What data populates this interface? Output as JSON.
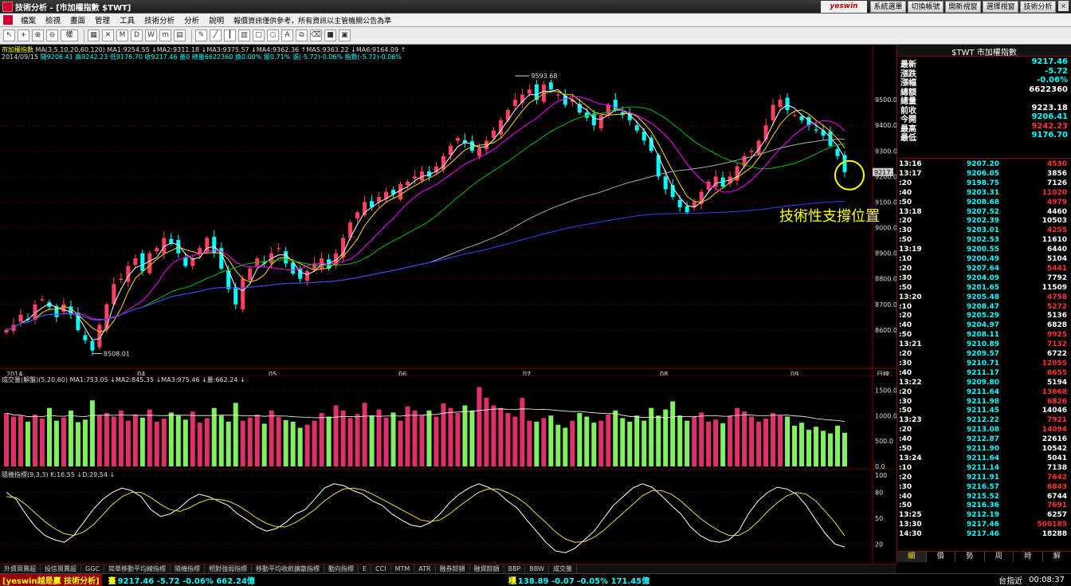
{
  "window": {
    "title": "技術分析 - [市加權指數 $TWT]",
    "brand": "yeswin",
    "right_buttons": [
      "系統選單",
      "切換帳號",
      "開新視窗",
      "選擇視窗",
      "技術分析"
    ],
    "win_controls": [
      "_",
      "▫",
      "×"
    ]
  },
  "menu": [
    "檔案",
    "檢視",
    "畫面",
    "管理",
    "工具",
    "技術分析",
    "分析",
    "說明"
  ],
  "disclaimer": "報價資訊僅供參考，所有資訊以主管機關公告為準",
  "toolbar": {
    "icons": [
      "cursor-icon",
      "crosshair-icon",
      "zoom-in-icon",
      "zoom-out-icon",
      "grid-icon",
      "close-chart-icon",
      "period-icon",
      "day-icon",
      "week-icon",
      "month-icon",
      "minute-icon",
      "draw-icon",
      "line-icon",
      "candle-icon",
      "bar-icon",
      "rect-icon",
      "circle-icon",
      "text-icon",
      "copy-icon",
      "eraser-icon",
      "color-icon",
      "save-icon"
    ],
    "rights_label": "權"
  },
  "main_chart": {
    "title_label": "市加權指數",
    "ma_line": "MA(3,5,10,20,60,120) MA1:9254.55 ↓MA2:9311.18 ↓MA3:9375.57 ↓MA4:9362.36 ↑MA5:9363.22 ↓MA6:9164.09 ↑",
    "date": "2014/09/15",
    "ohlc_line": "開9206.41 高9242.23 低9176.70 收9217.46 量0 總量6622360 換0.00% 振0.71% 漲(-5.72)-0.06% 指數(-5.72)-0.06%",
    "current_price_tag": "9217.5",
    "annotation": "技術性支撐位置",
    "x_axis_label": "日線"
  },
  "volume_chart": {
    "ma_line": "成交量(解盤)(5,20,60) MA1:753.05 ↓MA2:845.35 ↓MA3:975.46 ↓量:662.24 ↓"
  },
  "kd_chart": {
    "ma_line": "隨機指標(9,3,3) K:16.55 ↓D:29.54 ↓"
  },
  "chart_data": [
    {
      "type": "candlestick",
      "title": "市加權指數",
      "x": [
        "2014",
        "04",
        "05",
        "06",
        "07",
        "08",
        "09"
      ],
      "ylim": [
        8508.01,
        9593.68
      ],
      "y_ticks": [
        "9500.0",
        "9400.0",
        "9300.0",
        "9200.0",
        "9100.0",
        "9000.0",
        "8900.0",
        "8800.0",
        "8700.0",
        "8600.0"
      ],
      "annotations": [
        "9593.68",
        "8508.01"
      ],
      "series": [
        {
          "name": "MA1",
          "values": [
            9254.55
          ]
        },
        {
          "name": "MA2",
          "values": [
            9311.18
          ]
        },
        {
          "name": "MA3",
          "values": [
            9375.57
          ]
        },
        {
          "name": "MA4",
          "values": [
            9362.36
          ]
        },
        {
          "name": "MA5",
          "values": [
            9363.22
          ]
        },
        {
          "name": "MA6",
          "values": [
            9164.09
          ]
        }
      ],
      "close": [
        8600,
        8620,
        8660,
        8640,
        8700,
        8720,
        8690,
        8650,
        8700,
        8660,
        8600,
        8560,
        8520,
        8620,
        8700,
        8780,
        8800,
        8850,
        8880,
        8830,
        8900,
        8920,
        8960,
        8940,
        8900,
        8850,
        8880,
        8920,
        8960,
        8900,
        8840,
        8760,
        8700,
        8800,
        8840,
        8880,
        8860,
        8900,
        8920,
        8860,
        8820,
        8800,
        8830,
        8860,
        8880,
        8840,
        8900,
        8960,
        9020,
        9060,
        9100,
        9080,
        9120,
        9140,
        9130,
        9170,
        9180,
        9200,
        9220,
        9200,
        9240,
        9280,
        9320,
        9350,
        9330,
        9300,
        9310,
        9340,
        9380,
        9420,
        9460,
        9500,
        9520,
        9540,
        9500,
        9560,
        9540,
        9520,
        9480,
        9500,
        9450,
        9430,
        9400,
        9440,
        9480,
        9460,
        9440,
        9420,
        9380,
        9340,
        9300,
        9200,
        9150,
        9120,
        9080,
        9060,
        9100,
        9140,
        9180,
        9200,
        9160,
        9200,
        9240,
        9280,
        9300,
        9340,
        9400,
        9480,
        9500,
        9460,
        9440,
        9420,
        9400,
        9380,
        9360,
        9320,
        9280,
        9217.46
      ]
    },
    {
      "type": "bar",
      "title": "成交量(解盤)(5,20,60)",
      "ylim": [
        0,
        1500
      ],
      "y_ticks": [
        "1500.0",
        "1000.0",
        "500.0",
        "0.0"
      ],
      "series": [
        {
          "name": "MA1",
          "values": [
            753.05
          ]
        },
        {
          "name": "MA2",
          "values": [
            845.35
          ]
        },
        {
          "name": "MA3",
          "values": [
            975.46
          ]
        },
        {
          "name": "量",
          "values": [
            662.24
          ]
        }
      ],
      "values": [
        1050,
        980,
        1000,
        880,
        1020,
        940,
        1150,
        900,
        960,
        1100,
        870,
        920,
        1300,
        1000,
        1050,
        980,
        1100,
        900,
        1020,
        960,
        1120,
        880,
        940,
        1060,
        1000,
        920,
        1080,
        860,
        950,
        1150,
        1000,
        880,
        1250,
        900,
        960,
        1020,
        840,
        1100,
        970,
        910,
        880,
        760,
        820,
        900,
        1050,
        980,
        1200,
        1100,
        950,
        1030,
        1250,
        1000,
        1120,
        960,
        1060,
        900,
        1180,
        1100,
        1000,
        1100,
        980,
        1240,
        1150,
        1050,
        1200,
        1100,
        1560,
        1350,
        1200,
        1150,
        1050,
        980,
        1350,
        900,
        880,
        950,
        1000,
        820,
        760,
        900,
        1050,
        980,
        860,
        900,
        1020,
        1100,
        950,
        880,
        1000,
        900,
        1150,
        1000,
        1120,
        1280,
        1000,
        900,
        980,
        1060,
        880,
        920,
        850,
        1000,
        1150,
        1080,
        980,
        880,
        940,
        1050,
        1000,
        980,
        800,
        860,
        720,
        780,
        700,
        650,
        800,
        662.24
      ]
    },
    {
      "type": "line",
      "title": "隨機指標(9,3,3)",
      "ylim": [
        0,
        100
      ],
      "y_ticks": [
        "100",
        "80",
        "50",
        "20"
      ],
      "series": [
        {
          "name": "K",
          "values": [
            80,
            72,
            55,
            40,
            30,
            25,
            22,
            30,
            45,
            60,
            72,
            80,
            85,
            82,
            75,
            60,
            52,
            55,
            62,
            72,
            78,
            75,
            70,
            65,
            55,
            48,
            40,
            35,
            38,
            45,
            55,
            60,
            72,
            85,
            90,
            88,
            82,
            78,
            70,
            65,
            55,
            48,
            42,
            40,
            45,
            55,
            68,
            78,
            85,
            90,
            86,
            80,
            70,
            62,
            48,
            35,
            22,
            12,
            10,
            15,
            25,
            35,
            50,
            65,
            75,
            85,
            90,
            86,
            76,
            65,
            55,
            40,
            30,
            24,
            22,
            25,
            35,
            55,
            70,
            80,
            86,
            84,
            78,
            65,
            48,
            32,
            20,
            16.55
          ]
        },
        {
          "name": "D",
          "values": [
            75,
            74,
            66,
            56,
            46,
            38,
            32,
            30,
            34,
            42,
            54,
            66,
            75,
            80,
            80,
            74,
            66,
            60,
            58,
            62,
            68,
            72,
            72,
            70,
            65,
            58,
            50,
            44,
            40,
            40,
            45,
            52,
            60,
            70,
            78,
            84,
            85,
            83,
            78,
            72,
            66,
            60,
            54,
            48,
            46,
            48,
            55,
            64,
            72,
            80,
            84,
            84,
            80,
            74,
            66,
            55,
            45,
            34,
            26,
            22,
            23,
            28,
            36,
            46,
            56,
            66,
            76,
            82,
            82,
            78,
            70,
            60,
            50,
            42,
            35,
            30,
            30,
            36,
            46,
            58,
            68,
            76,
            80,
            78,
            70,
            58,
            45,
            29.54
          ]
        }
      ]
    }
  ],
  "quote_panel": {
    "title": "$TWT 市加權指數",
    "fields": [
      {
        "label": "最新",
        "value": "9217.46",
        "color": "#00ffff"
      },
      {
        "label": "漲跌",
        "value": "-5.72",
        "color": "#00ffff"
      },
      {
        "label": "漲幅",
        "value": "-0.06%",
        "color": "#00ffff"
      },
      {
        "label": "總額",
        "value": "6622360",
        "color": "#ffffff"
      },
      {
        "label": "總量",
        "value": "",
        "color": "#ffffff"
      },
      {
        "label": "前收",
        "value": "9223.18",
        "color": "#ffffff"
      },
      {
        "label": "今開",
        "value": "9206.41",
        "color": "#00ffff"
      },
      {
        "label": "最高",
        "value": "9242.23",
        "color": "#ff3030"
      },
      {
        "label": "最低",
        "value": "9176.70",
        "color": "#00ffff"
      }
    ],
    "ticks": [
      {
        "t": "13:16",
        "p": "9207.20",
        "v": "4530",
        "vc": "#ff3030"
      },
      {
        "t": "13:17",
        "p": "9206.05",
        "v": "3856",
        "vc": "#ffffff"
      },
      {
        "t": ":20",
        "p": "9198.75",
        "v": "7126",
        "vc": "#ffffff"
      },
      {
        "t": ":40",
        "p": "9203.31",
        "v": "11020",
        "vc": "#ff3030"
      },
      {
        "t": ":50",
        "p": "9208.68",
        "v": "4979",
        "vc": "#ff3030"
      },
      {
        "t": "13:18",
        "p": "9207.52",
        "v": "4460",
        "vc": "#ffffff"
      },
      {
        "t": ":20",
        "p": "9202.39",
        "v": "10503",
        "vc": "#ffffff"
      },
      {
        "t": ":30",
        "p": "9203.01",
        "v": "4255",
        "vc": "#ff3030"
      },
      {
        "t": ":50",
        "p": "9202.53",
        "v": "11610",
        "vc": "#ffffff"
      },
      {
        "t": "13:19",
        "p": "9200.55",
        "v": "6440",
        "vc": "#ffffff"
      },
      {
        "t": ":10",
        "p": "9200.49",
        "v": "5104",
        "vc": "#ffffff"
      },
      {
        "t": ":20",
        "p": "9207.64",
        "v": "5441",
        "vc": "#ff3030"
      },
      {
        "t": ":30",
        "p": "9204.09",
        "v": "7792",
        "vc": "#ffffff"
      },
      {
        "t": ":50",
        "p": "9201.65",
        "v": "11509",
        "vc": "#ffffff"
      },
      {
        "t": "13:20",
        "p": "9205.48",
        "v": "4758",
        "vc": "#ff3030"
      },
      {
        "t": ":10",
        "p": "9208.47",
        "v": "5272",
        "vc": "#ff3030"
      },
      {
        "t": ":20",
        "p": "9205.29",
        "v": "5136",
        "vc": "#ffffff"
      },
      {
        "t": ":40",
        "p": "9204.97",
        "v": "6828",
        "vc": "#ffffff"
      },
      {
        "t": ":50",
        "p": "9208.11",
        "v": "9925",
        "vc": "#ff3030"
      },
      {
        "t": "13:21",
        "p": "9210.89",
        "v": "7132",
        "vc": "#ff3030"
      },
      {
        "t": ":20",
        "p": "9209.57",
        "v": "6722",
        "vc": "#ffffff"
      },
      {
        "t": ":30",
        "p": "9210.71",
        "v": "12055",
        "vc": "#ff3030"
      },
      {
        "t": ":40",
        "p": "9211.17",
        "v": "6655",
        "vc": "#ff3030"
      },
      {
        "t": "13:22",
        "p": "9209.80",
        "v": "5194",
        "vc": "#ffffff"
      },
      {
        "t": ":20",
        "p": "9211.64",
        "v": "13668",
        "vc": "#ff3030"
      },
      {
        "t": ":30",
        "p": "9211.98",
        "v": "6826",
        "vc": "#ff3030"
      },
      {
        "t": ":50",
        "p": "9211.45",
        "v": "14046",
        "vc": "#ffffff"
      },
      {
        "t": "13:23",
        "p": "9212.22",
        "v": "7921",
        "vc": "#ff3030"
      },
      {
        "t": ":20",
        "p": "9213.08",
        "v": "14094",
        "vc": "#ff3030"
      },
      {
        "t": ":40",
        "p": "9212.87",
        "v": "22616",
        "vc": "#ffffff"
      },
      {
        "t": ":50",
        "p": "9211.90",
        "v": "10542",
        "vc": "#ffffff"
      },
      {
        "t": "13:24",
        "p": "9211.64",
        "v": "5041",
        "vc": "#ffffff"
      },
      {
        "t": ":10",
        "p": "9211.14",
        "v": "7138",
        "vc": "#ffffff"
      },
      {
        "t": ":20",
        "p": "9211.91",
        "v": "7642",
        "vc": "#ff3030"
      },
      {
        "t": ":30",
        "p": "9216.57",
        "v": "6843",
        "vc": "#ff3030"
      },
      {
        "t": ":40",
        "p": "9215.52",
        "v": "6744",
        "vc": "#ffffff"
      },
      {
        "t": ":50",
        "p": "9216.36",
        "v": "7691",
        "vc": "#ff3030"
      },
      {
        "t": "13:25",
        "p": "9212.19",
        "v": "6257",
        "vc": "#ffffff"
      },
      {
        "t": "13:30",
        "p": "9217.46",
        "v": "500185",
        "vc": "#ff3030"
      },
      {
        "t": "14:30",
        "p": "9217.46",
        "v": "18288",
        "vc": "#ffffff"
      }
    ],
    "tabs": [
      "細",
      "價",
      "勢",
      "周",
      "時",
      "解"
    ]
  },
  "bottom_tabs": [
    "外資買賣超",
    "投信買賣超",
    "GGC",
    "简單移動平均線指標",
    "隨機指標",
    "相對強弱指標",
    "移動平均收斂擴散指標",
    "動向指標",
    "E",
    "CCI",
    "MTM",
    "ATR",
    "融券餘額",
    "融資餘額",
    "BBP",
    "BBW",
    "成交量"
  ],
  "status": {
    "brand": "[yeswin越是贏 技術分析]",
    "taiex_label": "臺",
    "taiex": "9217.46 -5.72 -0.06% 662.24億",
    "otc_label": "櫃",
    "otc": "138.89 -0.07 -0.05% 171.45億",
    "account": "台指近",
    "clock": "00:08:37"
  }
}
